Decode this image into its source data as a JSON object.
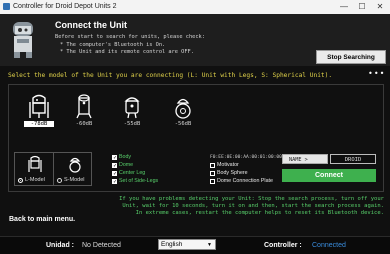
{
  "window": {
    "title": "Controller for Droid Depot Units 2",
    "btn_min": "—",
    "btn_max": "☐",
    "btn_close": "✕"
  },
  "header": {
    "title": "Connect the Unit",
    "subtitle": "Before start to search for units, please check:",
    "check1": "* The computer's Bluetooth is On.",
    "check2": "* The Unit and its remote control are OFF.",
    "stop_button": "Stop Searching"
  },
  "select_prompt": "Select the model of the Unit you are connecting (L: Unit with Legs, S: Spherical Unit).",
  "more_menu": "•••",
  "units": [
    {
      "signal": "-78dB",
      "selected": true
    },
    {
      "signal": "-60dB",
      "selected": false
    },
    {
      "signal": "-55dB",
      "selected": false
    },
    {
      "signal": "-56dB",
      "selected": false
    }
  ],
  "model_options": {
    "l_model": "L-Model",
    "s_model": "S-Model",
    "selected": "L-Model"
  },
  "parts_green": [
    {
      "label": "Body",
      "checked": true
    },
    {
      "label": "Dome",
      "checked": true
    },
    {
      "label": "Center Leg",
      "checked": true
    },
    {
      "label": "Set of Side-Legs",
      "checked": true
    }
  ],
  "parts_white": [
    {
      "label": "Motivator",
      "checked": false
    },
    {
      "label": "Body Sphere",
      "checked": false
    },
    {
      "label": "Dome Connection Plate",
      "checked": false
    }
  ],
  "device_code": "F0:EE:0E:00:AA:00:01:00:00:00",
  "name_button": "NAME >",
  "name_value": "DROID",
  "connect_button": "Connect",
  "help_lines": [
    "If you have problems detecting your Unit: Stop the search process, turn off your",
    "Unit, wait for 10 seconds, turn it on and then, start the search process again.",
    "In extreme cases, restart the computer helps to reset its Bluetooth device."
  ],
  "back_link": "Back to main menu.",
  "statusbar": {
    "unidad_label": "Unidad :",
    "unidad_value": "No Detected",
    "language": "English",
    "controller_label": "Controller :",
    "controller_value": "Connected"
  },
  "colors": {
    "accent_green": "#3eb04e",
    "text_green": "#58d06b",
    "prompt_yellow": "#e0d24a",
    "connected_blue": "#3a8dde"
  }
}
